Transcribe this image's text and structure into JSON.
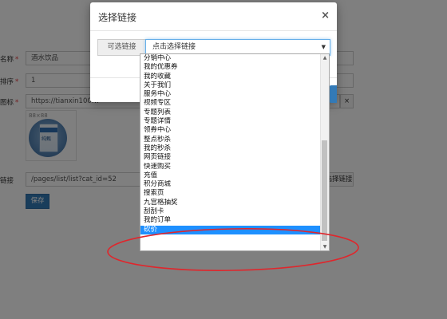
{
  "background_form": {
    "name_label": "名称",
    "name_value": "酒水饮品",
    "sort_label": "排序",
    "sort_value": "1",
    "icon_label": "图标",
    "icon_url": "https://tianxin100.w",
    "clear_symbol": "×",
    "thumb_dim": "88×88",
    "carton_text": "纯甄",
    "link_label": "链接",
    "link_value": "/pages/list/list?cat_id=52",
    "choose_link_button": "选择链接",
    "save_button": "保存",
    "required_mark": "*"
  },
  "modal": {
    "title": "选择链接",
    "close_symbol": "×",
    "addon_label": "可选链接",
    "select_value": "点击选择链接",
    "select_arrow": "▼"
  },
  "dropdown": {
    "items": [
      "分销中心",
      "我的优惠券",
      "我的收藏",
      "关于我们",
      "服务中心",
      "视频专区",
      "专题列表",
      "专题详情",
      "领券中心",
      "整点秒杀",
      "我的秒杀",
      "网页链接",
      "快速购买",
      "充值",
      "积分商城",
      "搜索页",
      "九宫格抽奖",
      "刮刮卡",
      "我的订单",
      "砍价"
    ],
    "selected_index": 19,
    "scroll_up": "▲",
    "scroll_down": "▼"
  },
  "colors": {
    "primary": "#337ab7",
    "selected_item": "#1e90ff",
    "annotation_ellipse": "#e0262c",
    "required": "#e4393c"
  }
}
